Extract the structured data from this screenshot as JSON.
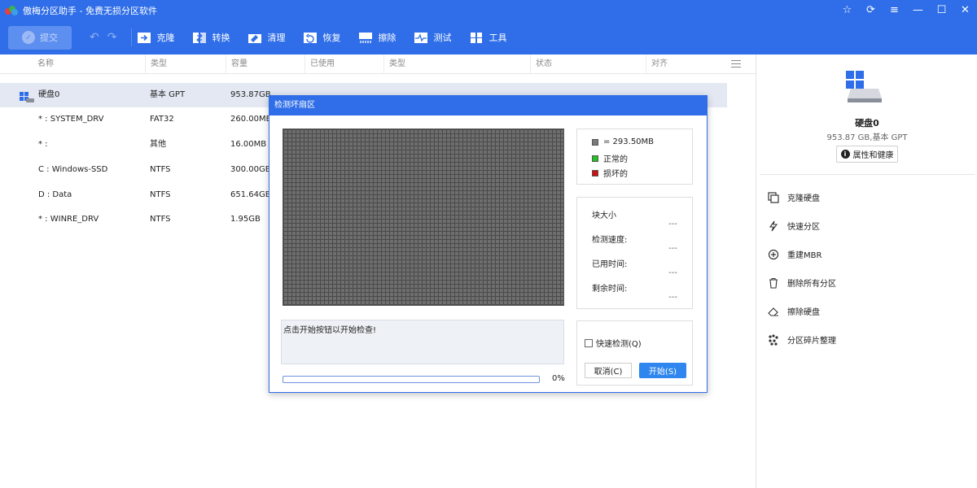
{
  "app": {
    "title": "傲梅分区助手 - 免费无损分区软件"
  },
  "toolbar": {
    "submit_label": "提交",
    "items": [
      {
        "label": "克隆",
        "icon": "clone-icon"
      },
      {
        "label": "转换",
        "icon": "convert-icon"
      },
      {
        "label": "清理",
        "icon": "clean-icon"
      },
      {
        "label": "恢复",
        "icon": "recover-icon"
      },
      {
        "label": "擦除",
        "icon": "wipe-icon"
      },
      {
        "label": "测试",
        "icon": "test-icon"
      },
      {
        "label": "工具",
        "icon": "tools-icon"
      }
    ]
  },
  "table": {
    "columns": [
      "名称",
      "类型",
      "容量",
      "已使用",
      "类型",
      "状态",
      "对齐"
    ],
    "rows": [
      {
        "name": "硬盘0",
        "type": "基本 GPT",
        "capacity": "953.87GB"
      },
      {
        "name": "* : SYSTEM_DRV",
        "type": "FAT32",
        "capacity": "260.00MB"
      },
      {
        "name": "* :",
        "type": "其他",
        "capacity": "16.00MB"
      },
      {
        "name": "C : Windows-SSD",
        "type": "NTFS",
        "capacity": "300.00GB"
      },
      {
        "name": "D : Data",
        "type": "NTFS",
        "capacity": "651.64GB"
      },
      {
        "name": "* : WINRE_DRV",
        "type": "NTFS",
        "capacity": "1.95GB"
      }
    ]
  },
  "right_panel": {
    "disk_name": "硬盘0",
    "disk_info": "953.87 GB,基本 GPT",
    "properties_label": "属性和健康",
    "actions": [
      {
        "label": "克隆硬盘",
        "icon": "clone-disk-icon"
      },
      {
        "label": "快速分区",
        "icon": "lightning-icon"
      },
      {
        "label": "重建MBR",
        "icon": "rebuild-mbr-icon"
      },
      {
        "label": "删除所有分区",
        "icon": "trash-icon"
      },
      {
        "label": "擦除硬盘",
        "icon": "eraser-icon"
      },
      {
        "label": "分区碎片整理",
        "icon": "defrag-icon"
      }
    ]
  },
  "dialog": {
    "title": "检测坏扇区",
    "legend": {
      "block_label": "= 293.50MB",
      "normal_label": "正常的",
      "bad_label": "损坏的"
    },
    "stats": {
      "block_size_label": "块大小",
      "block_size_value": "---",
      "speed_label": "检测速度:",
      "speed_value": "---",
      "elapsed_label": "已用时间:",
      "elapsed_value": "---",
      "remaining_label": "剩余时间:",
      "remaining_value": "---"
    },
    "message": "点击开始按钮以开始检查!",
    "progress_percent": 0,
    "progress_label": "0%",
    "quick_check_label": "快速检测(Q)",
    "quick_check_checked": false,
    "cancel_label": "取消(C)",
    "start_label": "开始(S)"
  },
  "colors": {
    "accent": "#2f6ee8",
    "normal": "#22c222",
    "bad": "#cc1111",
    "block": "#7a7a7a"
  }
}
